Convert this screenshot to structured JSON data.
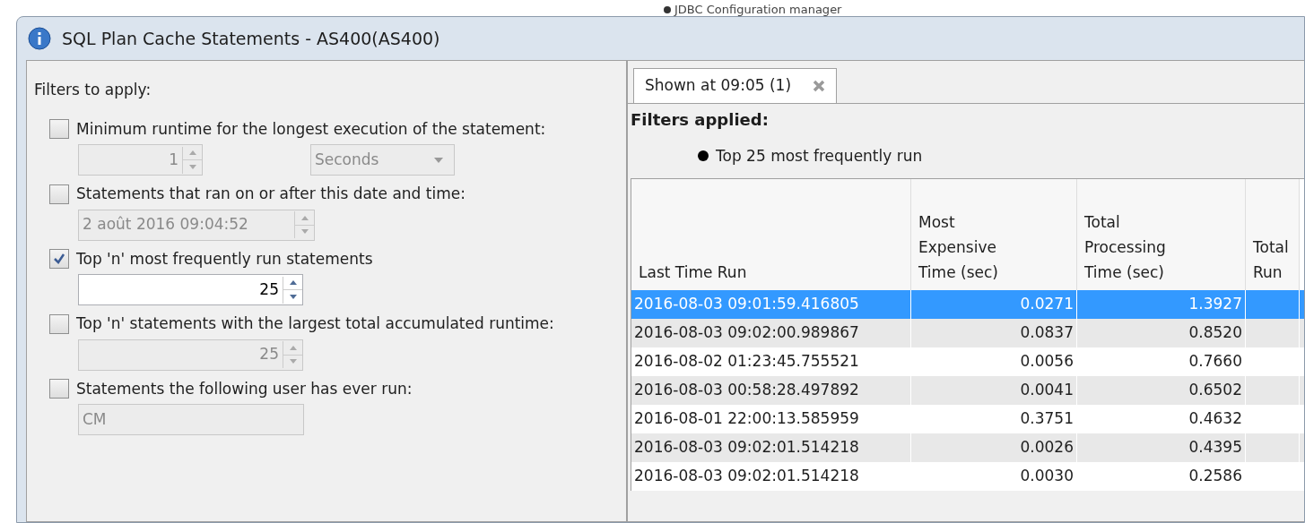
{
  "background_text": "JDBC Configuration manager",
  "window": {
    "title": "SQL Plan Cache Statements - AS400(AS400)"
  },
  "filters_panel": {
    "heading": "Filters to apply:",
    "filters": [
      {
        "label": "Minimum runtime for the longest execution of the statement:",
        "checked": false,
        "controls": [
          {
            "kind": "spinner",
            "value": "1",
            "disabled": true
          },
          {
            "kind": "dropdown",
            "value": "Seconds",
            "disabled": true
          }
        ]
      },
      {
        "label": "Statements that ran on or after this date and time:",
        "checked": false,
        "controls": [
          {
            "kind": "datetime",
            "value": "2 août 2016 09:04:52",
            "disabled": true
          }
        ]
      },
      {
        "label": "Top 'n' most frequently run statements",
        "checked": true,
        "controls": [
          {
            "kind": "number",
            "value": "25",
            "disabled": false
          }
        ]
      },
      {
        "label": "Top 'n' statements with the largest total accumulated runtime:",
        "checked": false,
        "controls": [
          {
            "kind": "number",
            "value": "25",
            "disabled": true
          }
        ]
      },
      {
        "label": "Statements the following user has ever run:",
        "checked": false,
        "controls": [
          {
            "kind": "text",
            "value": "CM",
            "disabled": true
          }
        ]
      }
    ]
  },
  "results": {
    "tabs": [
      {
        "label": "Shown at 09:05 (1)",
        "selected": true
      }
    ],
    "applied_heading": "Filters applied:",
    "applied_filters": [
      "Top 25 most frequently run"
    ],
    "table": {
      "columns": [
        {
          "lines": [
            "Last Time Run"
          ]
        },
        {
          "lines": [
            "Most",
            "Expensive",
            "Time (sec)"
          ]
        },
        {
          "lines": [
            "Total",
            "Processing",
            "Time (sec)"
          ]
        },
        {
          "lines": [
            "Total",
            "Run"
          ]
        }
      ],
      "rows": [
        {
          "cells": [
            "2016-08-03 09:01:59.416805",
            "0.0271",
            "1.3927"
          ],
          "selected": true
        },
        {
          "cells": [
            "2016-08-03 09:02:00.989867",
            "0.0837",
            "0.8520"
          ],
          "selected": false
        },
        {
          "cells": [
            "2016-08-02 01:23:45.755521",
            "0.0056",
            "0.7660"
          ],
          "selected": false
        },
        {
          "cells": [
            "2016-08-03 00:58:28.497892",
            "0.0041",
            "0.6502"
          ],
          "selected": false
        },
        {
          "cells": [
            "2016-08-01 22:00:13.585959",
            "0.3751",
            "0.4632"
          ],
          "selected": false
        },
        {
          "cells": [
            "2016-08-03 09:02:01.514218",
            "0.0026",
            "0.4395"
          ],
          "selected": false
        },
        {
          "cells": [
            "2016-08-03 09:02:01.514218",
            "0.0030",
            "0.2586"
          ],
          "selected": false
        }
      ]
    }
  }
}
